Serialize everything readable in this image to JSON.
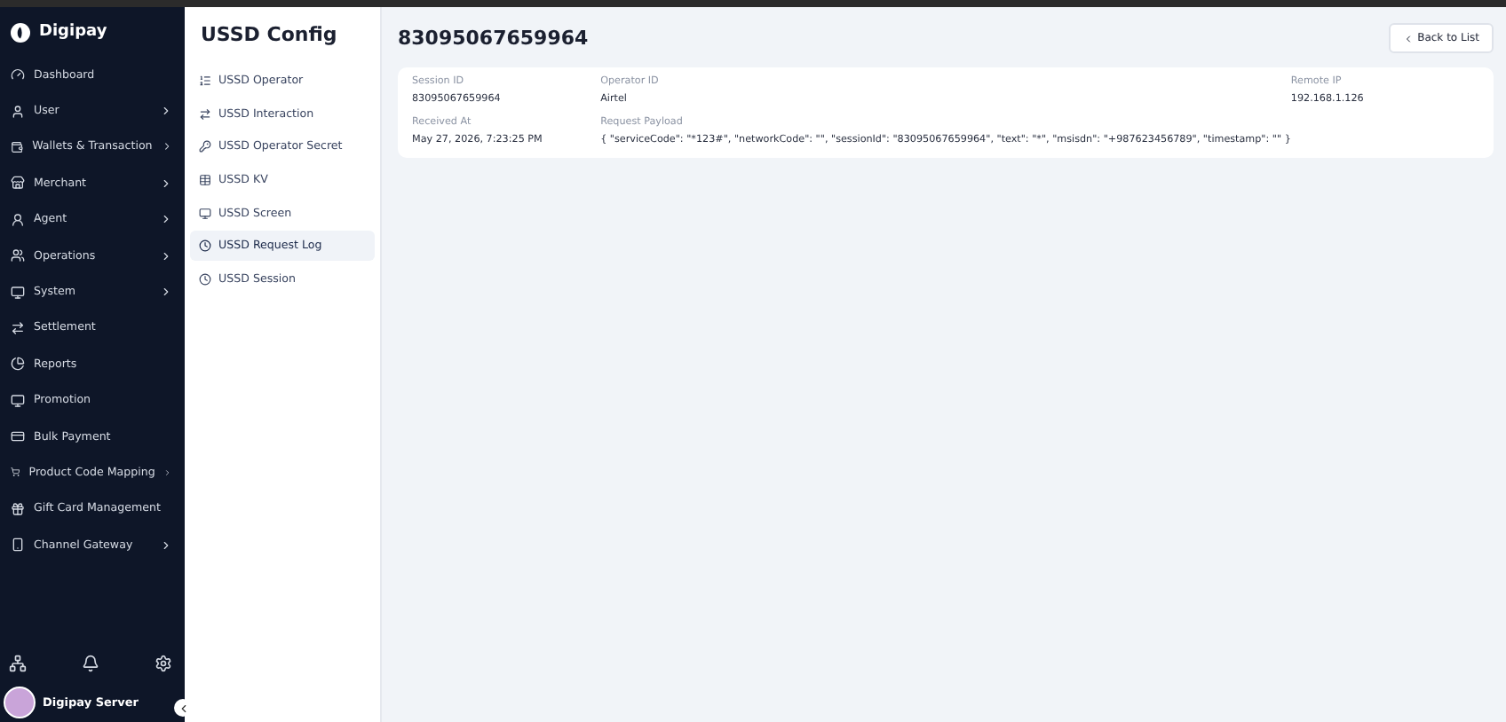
{
  "brand": {
    "name": "Digipay"
  },
  "sidebar": {
    "items": [
      {
        "label": "Dashboard",
        "expandable": false
      },
      {
        "label": "User",
        "expandable": true
      },
      {
        "label": "Wallets & Transaction",
        "expandable": true
      },
      {
        "label": "Merchant",
        "expandable": true
      },
      {
        "label": "Agent",
        "expandable": true
      },
      {
        "label": "Operations",
        "expandable": true
      },
      {
        "label": "System",
        "expandable": true
      },
      {
        "label": "Settlement",
        "expandable": false
      },
      {
        "label": "Reports",
        "expandable": false
      },
      {
        "label": "Promotion",
        "expandable": false
      },
      {
        "label": "Bulk Payment",
        "expandable": false
      },
      {
        "label": "Product Code Mapping",
        "expandable": true
      },
      {
        "label": "Gift Card Management",
        "expandable": false
      },
      {
        "label": "Channel Gateway",
        "expandable": true
      }
    ],
    "user": {
      "name": "Digipay Server"
    }
  },
  "submenu": {
    "title": "USSD Config",
    "items": [
      {
        "label": "USSD Operator",
        "selected": false
      },
      {
        "label": "USSD Interaction",
        "selected": false
      },
      {
        "label": "USSD Operator Secret",
        "selected": false
      },
      {
        "label": "USSD KV",
        "selected": false
      },
      {
        "label": "USSD Screen",
        "selected": false
      },
      {
        "label": "USSD Request Log",
        "selected": true
      },
      {
        "label": "USSD Session",
        "selected": false
      }
    ]
  },
  "page": {
    "title": "83095067659964",
    "back_button": "Back to List"
  },
  "details": [
    {
      "label": "Session ID",
      "value": "83095067659964"
    },
    {
      "label": "Operator ID",
      "value": "Airtel"
    },
    {
      "label": "Remote IP",
      "value": "192.168.1.126"
    },
    {
      "label": "Received At",
      "value": "May 27, 2026, 7:23:25 PM"
    },
    {
      "label": "Request Payload",
      "value": "{ \"serviceCode\": \"*123#\", \"networkCode\": \"\", \"sessionId\": \"83095067659964\", \"text\": \"*\", \"msisdn\": \"+987623456789\", \"timestamp\": \"\" }"
    }
  ]
}
